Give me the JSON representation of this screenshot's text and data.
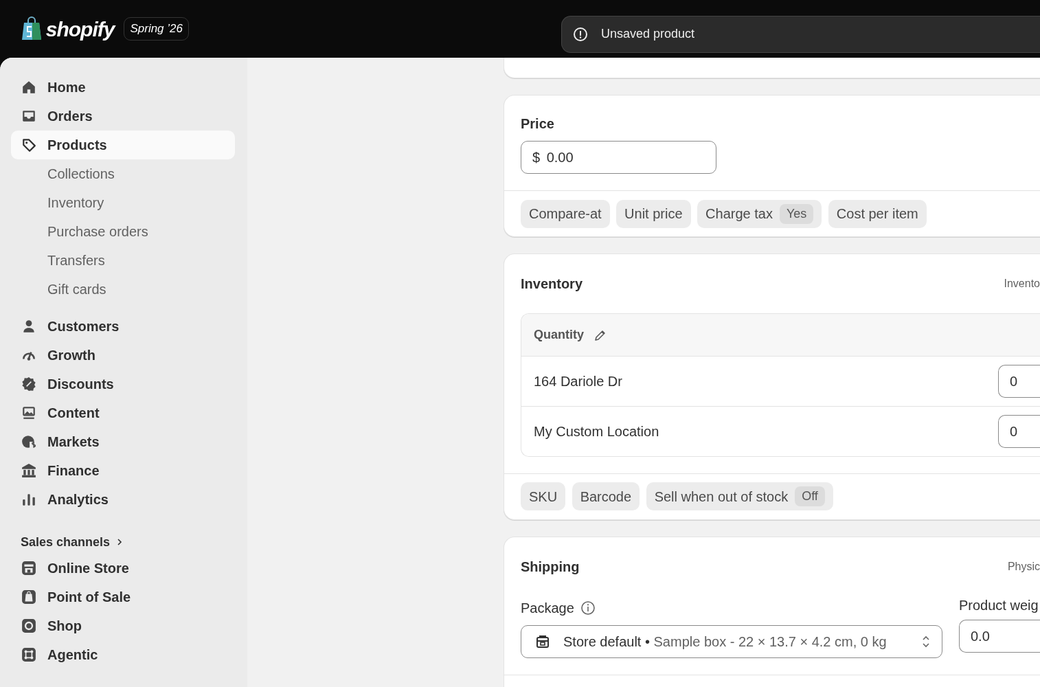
{
  "brand": {
    "logo_text": "shopify",
    "edition": "Spring ’26"
  },
  "notice": {
    "text": "Unsaved product"
  },
  "sidebar": {
    "items": [
      {
        "label": "Home",
        "kind": "main",
        "selected": false
      },
      {
        "label": "Orders",
        "kind": "main",
        "selected": false
      },
      {
        "label": "Products",
        "kind": "main",
        "selected": true
      },
      {
        "label": "Collections",
        "kind": "sub",
        "selected": false
      },
      {
        "label": "Inventory",
        "kind": "sub",
        "selected": false
      },
      {
        "label": "Purchase orders",
        "kind": "sub",
        "selected": false
      },
      {
        "label": "Transfers",
        "kind": "sub",
        "selected": false
      },
      {
        "label": "Gift cards",
        "kind": "sub",
        "selected": false
      },
      {
        "label": "Customers",
        "kind": "main",
        "selected": false
      },
      {
        "label": "Growth",
        "kind": "main",
        "selected": false
      },
      {
        "label": "Discounts",
        "kind": "main",
        "selected": false
      },
      {
        "label": "Content",
        "kind": "main",
        "selected": false
      },
      {
        "label": "Markets",
        "kind": "main",
        "selected": false
      },
      {
        "label": "Finance",
        "kind": "main",
        "selected": false
      },
      {
        "label": "Analytics",
        "kind": "main",
        "selected": false
      }
    ],
    "sales_channels": {
      "label": "Sales channels",
      "items": [
        {
          "label": "Online Store",
          "selected": false
        },
        {
          "label": "Point of Sale",
          "selected": false
        },
        {
          "label": "Shop",
          "selected": false
        },
        {
          "label": "Agentic",
          "selected": false
        }
      ]
    }
  },
  "price_card": {
    "title": "Price",
    "currency": "$",
    "value": "0.00",
    "chips": [
      {
        "label": "Compare-at"
      },
      {
        "label": "Unit price"
      },
      {
        "label": "Charge tax",
        "value": "Yes"
      },
      {
        "label": "Cost per item"
      }
    ]
  },
  "inventory_card": {
    "title": "Inventory",
    "aside": "Invento",
    "table": {
      "header": "Quantity",
      "rows": [
        {
          "location": "164 Dariole Dr",
          "quantity": "0"
        },
        {
          "location": "My Custom Location",
          "quantity": "0"
        }
      ]
    },
    "chips": [
      {
        "label": "SKU"
      },
      {
        "label": "Barcode"
      },
      {
        "label": "Sell when out of stock",
        "value": "Off"
      }
    ]
  },
  "shipping_card": {
    "title": "Shipping",
    "aside": "Physic",
    "package": {
      "label": "Package",
      "name": "Store default",
      "separator": "•",
      "detail": "Sample box - 22 × 13.7 × 4.2 cm, 0 kg"
    },
    "weight": {
      "label": "Product weig",
      "value": "0.0"
    }
  }
}
